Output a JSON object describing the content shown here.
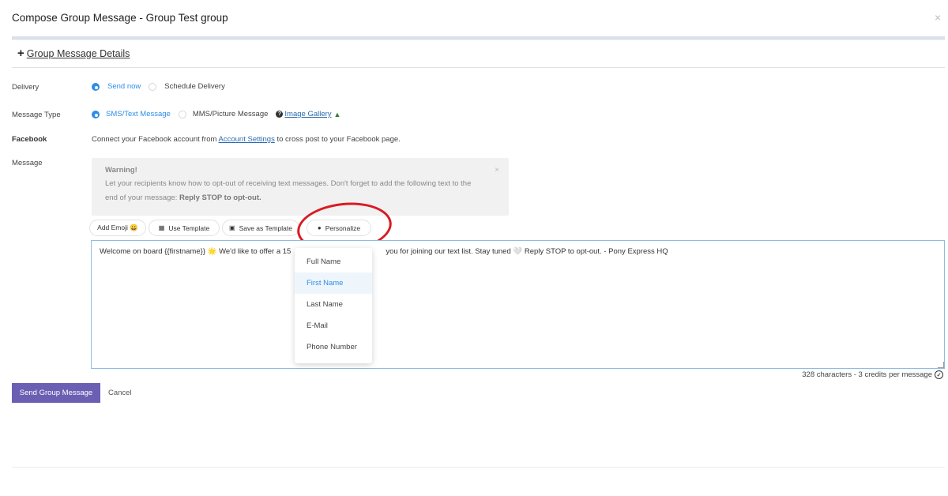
{
  "modal": {
    "title": "Compose Group Message - Group Test group",
    "close": "×"
  },
  "details_toggle": {
    "icon": "+",
    "label": "Group Message Details"
  },
  "delivery": {
    "label": "Delivery",
    "options": [
      "Send now",
      "Schedule Delivery"
    ],
    "selected": "Send now"
  },
  "message_type": {
    "label": "Message Type",
    "options": [
      "SMS/Text Message",
      "MMS/Picture Message"
    ],
    "selected": "SMS/Text Message",
    "help_icon": "?",
    "gallery_link": "Image Gallery",
    "gallery_icon": "tree-icon"
  },
  "facebook": {
    "label": "Facebook",
    "text_before": "Connect your Facebook account from ",
    "link": "Account Settings",
    "text_after": " to cross post to your Facebook page."
  },
  "message": {
    "label": "Message",
    "warning": {
      "title": "Warning!",
      "body_line1": "Let your recipients know how to opt-out of receiving text messages. Don't forget to add the following text to the",
      "body_line2": "end of your message: ",
      "body_bold": "Reply STOP to opt-out.",
      "close": "×"
    },
    "toolbar": {
      "add_emoji": "Add Emoji 😀",
      "use_template": "Use Template",
      "save_template": "Save as Template",
      "personalize": "Personalize"
    },
    "text_value_left": "Welcome on board {{firstname}} 🌟 We'd like to offer a 15",
    "text_value_right": "you for joining our text list. Stay tuned 🤍 Reply STOP to opt-out. - Pony Express HQ"
  },
  "personalize_menu": {
    "items": [
      "Full Name",
      "First Name",
      "Last Name",
      "E-Mail",
      "Phone Number"
    ],
    "highlighted": "First Name"
  },
  "counter": {
    "text": "328 characters - 3 credits per message",
    "icon": "check-circle-icon"
  },
  "actions": {
    "send": "Send Group Message",
    "cancel": "Cancel"
  },
  "colors": {
    "accent": "#2e8de6",
    "primary_button": "#6b5fb3",
    "annotation_circle": "#d81b23"
  }
}
